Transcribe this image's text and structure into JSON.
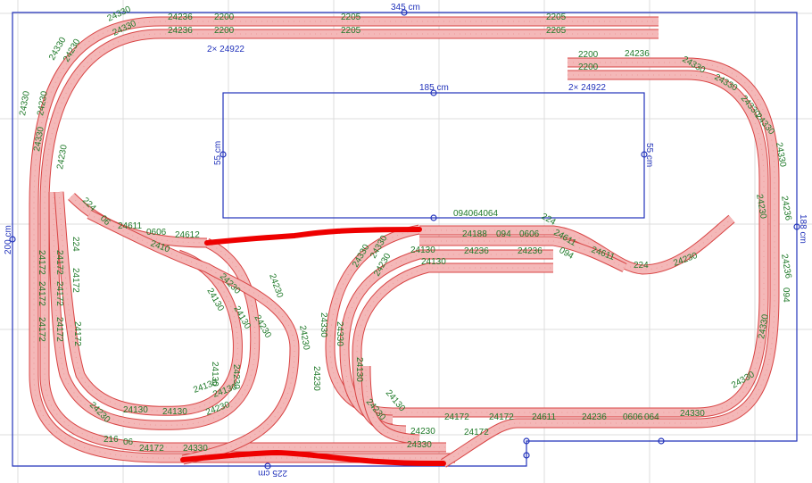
{
  "colors": {
    "background": "#ffffff",
    "grid": "#dcdcdc",
    "outline": "#2233bb",
    "track_fill": "#f4b8b8",
    "track_edge": "#d84444",
    "label": "#207a2a",
    "highlight": "#ee0000"
  },
  "dimensions": {
    "outer_width": "345 cm",
    "outer_height": "200 cm",
    "right_height": "188 cm",
    "bottom_width": "225 cm",
    "inner_width": "185 cm",
    "inner_height_left": "55 cm",
    "inner_height_right": "55 cm",
    "double_count_top_left": "2× 24922",
    "double_count_top_right": "2× 24922"
  },
  "track_labels": [
    "24236",
    "2200",
    "2205",
    "2205",
    "24236",
    "2200",
    "2205",
    "2205",
    "24330",
    "24330",
    "24330",
    "24230",
    "24330",
    "24230",
    "24330",
    "24230",
    "224",
    "06",
    "24611",
    "0606",
    "24612",
    "2410",
    "24230",
    "24130",
    "24130",
    "24230",
    "24230",
    "24230",
    "24130",
    "24230",
    "24130",
    "24130",
    "24230",
    "24130",
    "24130",
    "24230",
    "216",
    "06",
    "24172",
    "24330",
    "24172",
    "24172",
    "24172",
    "24172",
    "24172",
    "24172",
    "24172",
    "24172",
    "224",
    "2200",
    "24236",
    "2200",
    "24330",
    "24330",
    "24330",
    "24330",
    "24330",
    "24230",
    "24236",
    "24236",
    "094",
    "24330",
    "24330",
    "094064064",
    "224",
    "24188",
    "094",
    "0606",
    "24611",
    "24611",
    "224",
    "24230",
    "24236",
    "24236",
    "24130",
    "094",
    "24330",
    "24330",
    "24230",
    "24130",
    "24330",
    "24330",
    "24230",
    "24130",
    "24230",
    "24130",
    "24172",
    "24172",
    "24611",
    "24236",
    "0606",
    "064",
    "24330",
    "24230",
    "24330",
    "24172"
  ]
}
